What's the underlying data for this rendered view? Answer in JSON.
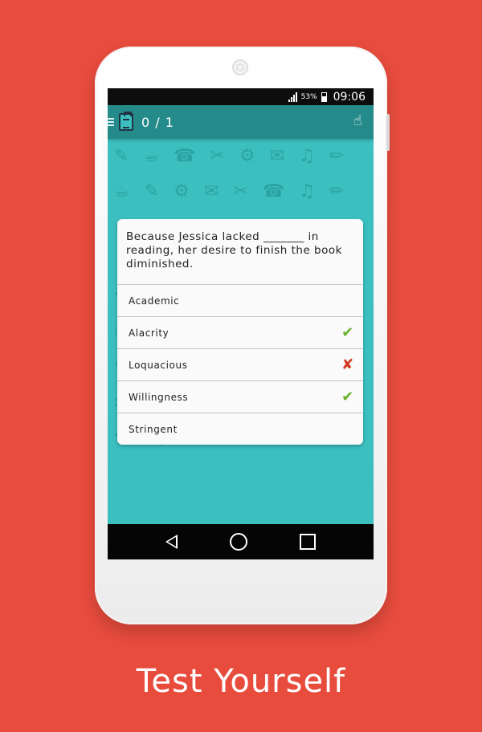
{
  "status_bar": {
    "battery_percent": "53%",
    "time": "09:06"
  },
  "toolbar": {
    "counter": "0 / 1"
  },
  "quiz": {
    "question": "Because Jessica lacked _______ in reading, her desire to finish the book diminished.",
    "options": [
      {
        "label": "Academic",
        "mark": ""
      },
      {
        "label": "Alacrity",
        "mark": "correct"
      },
      {
        "label": "Loquacious",
        "mark": "wrong"
      },
      {
        "label": "Willingness",
        "mark": "correct"
      },
      {
        "label": "Stringent",
        "mark": ""
      }
    ],
    "mark_symbols": {
      "correct": "✔",
      "wrong": "✘"
    },
    "mark_colors": {
      "correct": "#68b32e",
      "wrong": "#d23a1f"
    }
  },
  "pattern_glyphs": "✎☕☎✂⚙✉♫✏☕✎⚙✉✂☎♫✏☕⚙✎✉☎✂♫✏⚙☕✎✉✂☎♫✏☕⚙✎✉☎✂♫✏⚙☕✎✉✂☎♫✏☕⚙✎✉☎✂♫✏⚙☕✎✉✂☎♫✏☕⚙✎✉",
  "tagline": "Test Yourself",
  "colors": {
    "background": "#e84c3d",
    "screen": "#3cbfbf"
  }
}
